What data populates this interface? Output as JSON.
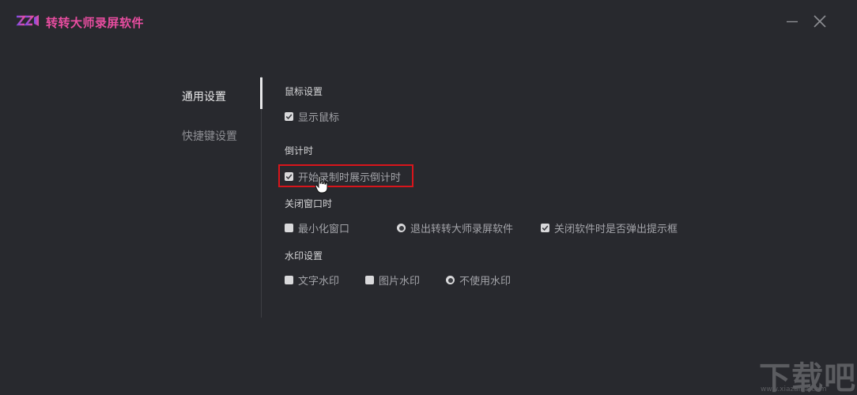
{
  "app": {
    "title": "转转大师录屏软件",
    "logo_text": "ZZ"
  },
  "window_controls": {
    "minimize_icon": "minimize-icon",
    "close_icon": "close-icon"
  },
  "sidebar": {
    "items": [
      {
        "label": "通用设置",
        "active": true
      },
      {
        "label": "快捷键设置",
        "active": false
      }
    ]
  },
  "sections": {
    "mouse": {
      "title": "鼠标设置",
      "options": [
        {
          "label": "显示鼠标",
          "checked": true
        }
      ]
    },
    "countdown": {
      "title": "倒计时",
      "options": [
        {
          "label": "开始录制时展示倒计时",
          "checked": true
        }
      ]
    },
    "close_window": {
      "title": "关闭窗口时",
      "options": [
        {
          "label": "最小化窗口",
          "type": "radio",
          "selected": false
        },
        {
          "label": "退出转转大师录屏软件",
          "type": "radio",
          "selected": true
        },
        {
          "label": "关闭软件时是否弹出提示框",
          "type": "checkbox",
          "checked": true
        }
      ]
    },
    "watermark": {
      "title": "水印设置",
      "options": [
        {
          "label": "文字水印",
          "selected": false
        },
        {
          "label": "图片水印",
          "selected": false
        },
        {
          "label": "不使用水印",
          "selected": true
        }
      ]
    }
  },
  "site_watermark": {
    "text": "下载吧",
    "url": "www.xiazaiba.com"
  },
  "colors": {
    "background": "#28292e",
    "brand": "#e84da0",
    "highlight": "#d8151b"
  }
}
